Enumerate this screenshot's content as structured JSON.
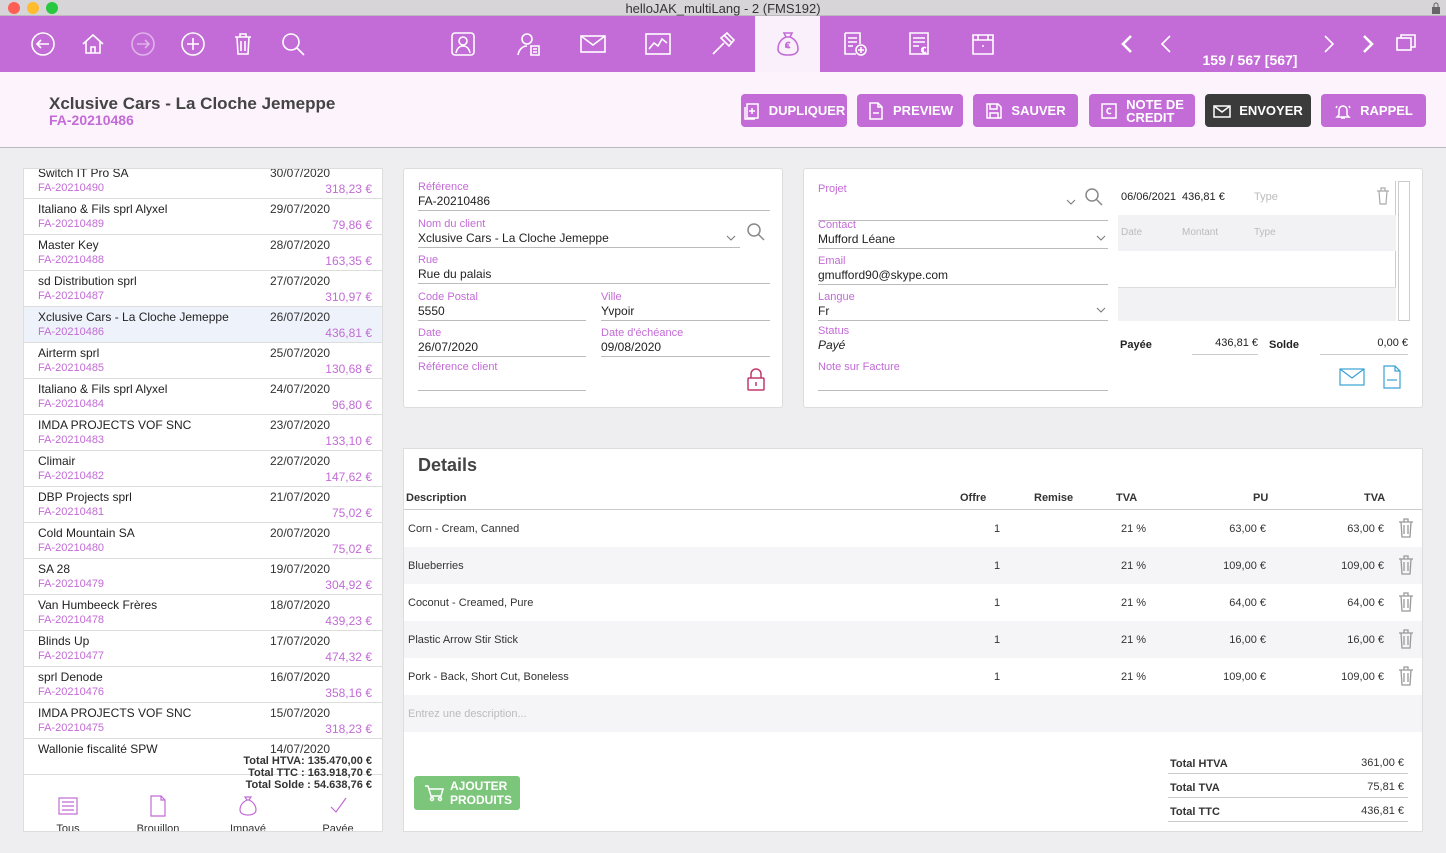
{
  "window": {
    "title": "helloJAK_multiLang - 2 (FMS192)"
  },
  "toolbar": {
    "record_position": "159 / 567 [567]",
    "icons_left": [
      "back-icon",
      "home-icon",
      "forward-icon",
      "add-icon",
      "trash-icon",
      "search-icon"
    ],
    "icons_modules": [
      "contacts-icon",
      "user-card-icon",
      "mail-icon",
      "chart-icon",
      "hammer-icon",
      "money-bag-icon",
      "invoice-add-icon",
      "invoice-euro-icon",
      "archive-icon"
    ],
    "active_module": "money-bag-icon"
  },
  "header": {
    "customer": "Xclusive Cars - La Cloche Jemeppe",
    "invoice_number": "FA-20210486",
    "buttons": {
      "duplicate": "DUPLIQUER",
      "preview": "PREVIEW",
      "save": "SAUVER",
      "credit_note_line1": "NOTE DE",
      "credit_note_line2": "CREDIT",
      "send": "ENVOYER",
      "reminder": "RAPPEL"
    }
  },
  "list": {
    "items": [
      {
        "name": "Switch IT Pro SA",
        "number": "FA-20210490",
        "date": "30/07/2020",
        "amount": "318,23 €"
      },
      {
        "name": "Italiano & Fils sprl Alyxel",
        "number": "FA-20210489",
        "date": "29/07/2020",
        "amount": "79,86 €"
      },
      {
        "name": "Master Key",
        "number": "FA-20210488",
        "date": "28/07/2020",
        "amount": "163,35 €"
      },
      {
        "name": "sd Distribution sprl",
        "number": "FA-20210487",
        "date": "27/07/2020",
        "amount": "310,97 €"
      },
      {
        "name": "Xclusive Cars - La Cloche Jemeppe",
        "number": "FA-20210486",
        "date": "26/07/2020",
        "amount": "436,81 €"
      },
      {
        "name": "Airterm sprl",
        "number": "FA-20210485",
        "date": "25/07/2020",
        "amount": "130,68 €"
      },
      {
        "name": "Italiano & Fils sprl Alyxel",
        "number": "FA-20210484",
        "date": "24/07/2020",
        "amount": "96,80 €"
      },
      {
        "name": "IMDA PROJECTS VOF SNC",
        "number": "FA-20210483",
        "date": "23/07/2020",
        "amount": "133,10 €"
      },
      {
        "name": "Climair",
        "number": "FA-20210482",
        "date": "22/07/2020",
        "amount": "147,62 €"
      },
      {
        "name": "DBP Projects sprl",
        "number": "FA-20210481",
        "date": "21/07/2020",
        "amount": "75,02 €"
      },
      {
        "name": "Cold Mountain SA",
        "number": "FA-20210480",
        "date": "20/07/2020",
        "amount": "75,02 €"
      },
      {
        "name": "SA 28",
        "number": "FA-20210479",
        "date": "19/07/2020",
        "amount": "304,92 €"
      },
      {
        "name": "Van Humbeeck Frères",
        "number": "FA-20210478",
        "date": "18/07/2020",
        "amount": "439,23 €"
      },
      {
        "name": "Blinds Up",
        "number": "FA-20210477",
        "date": "17/07/2020",
        "amount": "474,32 €"
      },
      {
        "name": "sprl Denode",
        "number": "FA-20210476",
        "date": "16/07/2020",
        "amount": "358,16 €"
      },
      {
        "name": "IMDA PROJECTS VOF SNC",
        "number": "FA-20210475",
        "date": "15/07/2020",
        "amount": "318,23 €"
      },
      {
        "name": "Wallonie fiscalité SPW",
        "number": "",
        "date": "14/07/2020",
        "amount": ""
      }
    ],
    "selected_index": 4,
    "totals": {
      "htva": "Total HTVA: 135.470,00 €",
      "ttc": "Total TTC : 163.918,70 €",
      "solde": "Total Solde : 54.638,76 €"
    },
    "filters": {
      "all": "Tous",
      "draft": "Brouillon",
      "unpaid": "Impayé",
      "paid": "Payée"
    }
  },
  "form": {
    "reference": {
      "label": "Référence",
      "value": "FA-20210486"
    },
    "client": {
      "label": "Nom du client",
      "value": "Xclusive Cars - La Cloche Jemeppe"
    },
    "street": {
      "label": "Rue",
      "value": "Rue du palais"
    },
    "postal": {
      "label": "Code Postal",
      "value": "5550"
    },
    "city": {
      "label": "Ville",
      "value": "Yvpoir"
    },
    "date": {
      "label": "Date",
      "value": "26/07/2020"
    },
    "due": {
      "label": "Date d'échéance",
      "value": "09/08/2020"
    },
    "client_ref": {
      "label": "Référence client",
      "value": ""
    }
  },
  "contact": {
    "project": {
      "label": "Projet",
      "value": ""
    },
    "contact": {
      "label": "Contact",
      "value": "Mufford Léane"
    },
    "email": {
      "label": "Email",
      "value": "gmufford90@skype.com"
    },
    "language": {
      "label": "Langue",
      "value": "Fr"
    },
    "status": {
      "label": "Status",
      "value": "Payé"
    },
    "note": {
      "label": "Note sur Facture",
      "value": ""
    }
  },
  "payments": {
    "row": {
      "date": "06/06/2021",
      "amount": "436,81 €",
      "type_placeholder": "Type"
    },
    "new_row": {
      "date": "Date",
      "amount": "Montant",
      "type": "Type"
    },
    "paid_label": "Payée",
    "paid_value": "436,81 €",
    "balance_label": "Solde",
    "balance_value": "0,00 €"
  },
  "details": {
    "title": "Details",
    "headers": {
      "description": "Description",
      "offer": "Offre",
      "discount": "Remise",
      "vat": "TVA",
      "unit": "PU",
      "vat_total": "TVA"
    },
    "lines": [
      {
        "description": "Corn - Cream, Canned",
        "qty": "1",
        "vat": "21 %",
        "unit": "63,00 €",
        "total": "63,00 €"
      },
      {
        "description": "Blueberries",
        "qty": "1",
        "vat": "21 %",
        "unit": "109,00 €",
        "total": "109,00 €"
      },
      {
        "description": "Coconut - Creamed, Pure",
        "qty": "1",
        "vat": "21 %",
        "unit": "64,00 €",
        "total": "64,00 €"
      },
      {
        "description": "Plastic Arrow Stir Stick",
        "qty": "1",
        "vat": "21 %",
        "unit": "16,00 €",
        "total": "16,00 €"
      },
      {
        "description": "Pork - Back, Short Cut, Boneless",
        "qty": "1",
        "vat": "21 %",
        "unit": "109,00 €",
        "total": "109,00 €"
      }
    ],
    "new_line_placeholder": "Entrez une description...",
    "add_line1": "AJOUTER",
    "add_line2": "PRODUITS",
    "totals": {
      "htva_label": "Total HTVA",
      "htva": "361,00 €",
      "tva_label": "Total TVA",
      "tva": "75,81 €",
      "ttc_label": "Total TTC",
      "ttc": "436,81 €"
    }
  },
  "colors": {
    "accent": "#c36bd6",
    "green": "#7cc67b",
    "dark_button": "#3b3b3b"
  }
}
